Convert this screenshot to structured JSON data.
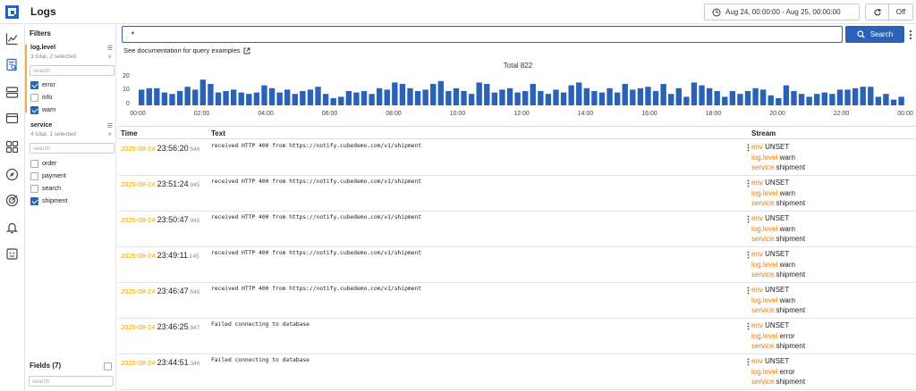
{
  "header": {
    "title": "Logs",
    "date_range": "Aug 24, 00:00:00 - Aug 25, 00:00:00",
    "auto_refresh": "Off"
  },
  "icons": {
    "logo": "cube-logo-icon",
    "nav": [
      "chart-line-icon",
      "log-search-icon",
      "storage-icon",
      "card-icon",
      "dashboard-grid-icon",
      "compass-icon",
      "target-icon",
      "bell-icon",
      "robot-icon"
    ],
    "date": "clock-icon",
    "refresh": "refresh-icon",
    "search": "search-icon",
    "external": "external-link-icon"
  },
  "colors": {
    "accent": "#2a62b8",
    "bar": "#2a62b8",
    "date": "#f0a000",
    "stream_key": "#f07a00",
    "filter_highlight": "#f0ad4e"
  },
  "filters": {
    "title": "Filters",
    "groups": [
      {
        "name": "log.level",
        "summary": "3 total, 2 selected",
        "search_placeholder": "search",
        "options": [
          {
            "label": "error",
            "checked": true
          },
          {
            "label": "info",
            "checked": false
          },
          {
            "label": "warn",
            "checked": true
          }
        ]
      },
      {
        "name": "service",
        "summary": "4 total, 1 selected",
        "search_placeholder": "search",
        "options": [
          {
            "label": "order",
            "checked": false
          },
          {
            "label": "payment",
            "checked": false
          },
          {
            "label": "search",
            "checked": false
          },
          {
            "label": "shipment",
            "checked": true
          }
        ]
      }
    ],
    "fields_title": "Fields (7)",
    "fields_search_placeholder": "search"
  },
  "query": {
    "value": "*",
    "search_label": "Search",
    "doc_link": "See documentation for query examples"
  },
  "chart_data": {
    "type": "bar",
    "title": "Total 822",
    "xlabel": "",
    "ylabel": "",
    "ylim": [
      0,
      20
    ],
    "yticks": [
      "20",
      "10",
      "0"
    ],
    "xticks": [
      "00:00",
      "02:00",
      "04:00",
      "06:00",
      "08:00",
      "10:00",
      "12:00",
      "14:00",
      "16:00",
      "18:00",
      "20:00",
      "22:00",
      "00:00"
    ],
    "x_start_hour": 0,
    "x_end_hour": 24,
    "bin_minutes": 15,
    "values": [
      11,
      12,
      12,
      9,
      8,
      10,
      13,
      11,
      18,
      15,
      9,
      10,
      11,
      9,
      8,
      9,
      14,
      12,
      9,
      11,
      8,
      10,
      11,
      13,
      8,
      5,
      6,
      10,
      9,
      10,
      8,
      12,
      11,
      16,
      15,
      12,
      10,
      11,
      15,
      17,
      10,
      12,
      10,
      8,
      16,
      15,
      9,
      11,
      12,
      9,
      10,
      15,
      10,
      8,
      11,
      9,
      14,
      16,
      12,
      10,
      9,
      12,
      9,
      15,
      11,
      12,
      13,
      10,
      15,
      8,
      12,
      6,
      16,
      14,
      12,
      10,
      6,
      10,
      8,
      10,
      12,
      11,
      7,
      5,
      14,
      10,
      8,
      6,
      8,
      9,
      8,
      11,
      11,
      12,
      13,
      13,
      6,
      8,
      4,
      6
    ]
  },
  "table": {
    "columns": [
      "Time",
      "Text",
      "Stream"
    ],
    "rows": [
      {
        "date": "2025-08-24",
        "time": "23:56:20",
        "ms": ".546",
        "text": "received HTTP 400 from https://notify.cubedemo.com/v1/shipment",
        "stream": [
          [
            "env",
            "UNSET"
          ],
          [
            "log.level",
            "warn"
          ],
          [
            "service",
            "shipment"
          ]
        ]
      },
      {
        "date": "2025-08-24",
        "time": "23:51:24",
        "ms": ".945",
        "text": "received HTTP 400 from https://notify.cubedemo.com/v1/shipment",
        "stream": [
          [
            "env",
            "UNSET"
          ],
          [
            "log.level",
            "warn"
          ],
          [
            "service",
            "shipment"
          ]
        ]
      },
      {
        "date": "2025-08-24",
        "time": "23:50:47",
        "ms": ".945",
        "text": "received HTTP 400 from https://notify.cubedemo.com/v1/shipment",
        "stream": [
          [
            "env",
            "UNSET"
          ],
          [
            "log.level",
            "warn"
          ],
          [
            "service",
            "shipment"
          ]
        ]
      },
      {
        "date": "2025-08-24",
        "time": "23:49:11",
        "ms": ".145",
        "text": "received HTTP 400 from https://notify.cubedemo.com/v1/shipment",
        "stream": [
          [
            "env",
            "UNSET"
          ],
          [
            "log.level",
            "warn"
          ],
          [
            "service",
            "shipment"
          ]
        ]
      },
      {
        "date": "2025-08-24",
        "time": "23:46:47",
        "ms": ".545",
        "text": "received HTTP 400 from https://notify.cubedemo.com/v1/shipment",
        "stream": [
          [
            "env",
            "UNSET"
          ],
          [
            "log.level",
            "warn"
          ],
          [
            "service",
            "shipment"
          ]
        ]
      },
      {
        "date": "2025-08-24",
        "time": "23:46:25",
        "ms": ".947",
        "text": "Failed connecting to database",
        "stream": [
          [
            "env",
            "UNSET"
          ],
          [
            "log.level",
            "error"
          ],
          [
            "service",
            "shipment"
          ]
        ]
      },
      {
        "date": "2025-08-24",
        "time": "23:44:51",
        "ms": ".346",
        "text": "Failed connecting to database",
        "stream": [
          [
            "env",
            "UNSET"
          ],
          [
            "log.level",
            "error"
          ],
          [
            "service",
            "shipment"
          ]
        ]
      }
    ]
  }
}
